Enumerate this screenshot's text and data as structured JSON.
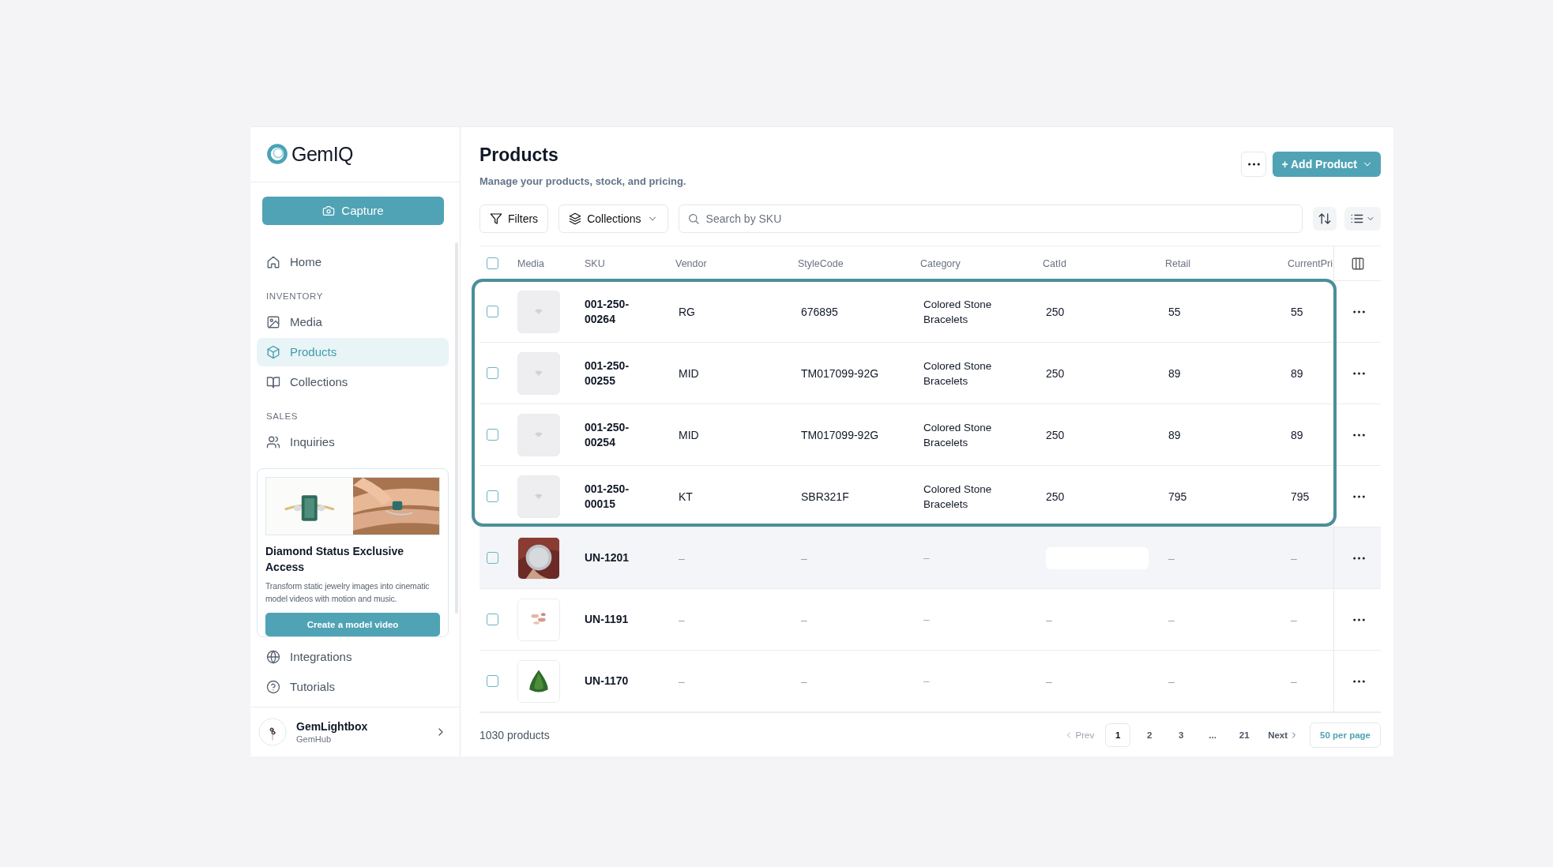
{
  "sidebar": {
    "logo": "GemIQ",
    "capture_button": "Capture",
    "top_items": [
      {
        "label": "Home",
        "selected": false
      }
    ],
    "sections": [
      {
        "heading": "INVENTORY",
        "items": [
          {
            "label": "Media",
            "selected": false
          },
          {
            "label": "Products",
            "selected": true
          },
          {
            "label": "Collections",
            "selected": false
          }
        ]
      },
      {
        "heading": "SALES",
        "items": [
          {
            "label": "Inquiries",
            "selected": false
          }
        ]
      }
    ],
    "promo": {
      "title": "Diamond Status Exclusive Access",
      "text": "Transform static jewelry images into cinematic model videos with motion and music.",
      "button": "Create a model video"
    },
    "bottom_items": [
      {
        "label": "Integrations",
        "selected": false
      },
      {
        "label": "Tutorials",
        "selected": false
      }
    ],
    "account": {
      "name": "GemLightbox",
      "org": "GemHub"
    }
  },
  "header": {
    "title": "Products",
    "subtitle": "Manage your products, stock, and pricing.",
    "add_button": "+ Add Product"
  },
  "toolbar": {
    "filters": "Filters",
    "collections": "Collections",
    "search": {
      "placeholder": "Search by SKU"
    }
  },
  "table": {
    "select_all_checked": false,
    "columns": [
      "Media",
      "SKU",
      "Vendor",
      "StyleCode",
      "Category",
      "CatId",
      "Retail",
      "CurrentPri"
    ],
    "rows": [
      {
        "media": {
          "kind": "placeholder"
        },
        "sku": "001-250-00264",
        "vendor": "RG",
        "style_code": "676895",
        "category": "Colored Stone Bracelets",
        "cat_id": "250",
        "retail": "55",
        "current_price": "55",
        "checked": false,
        "outlined": true,
        "hovered": false
      },
      {
        "media": {
          "kind": "placeholder"
        },
        "sku": "001-250-00255",
        "vendor": "MID",
        "style_code": "TM017099-92G",
        "category": "Colored Stone Bracelets",
        "cat_id": "250",
        "retail": "89",
        "current_price": "89",
        "checked": false,
        "outlined": true,
        "hovered": false
      },
      {
        "media": {
          "kind": "placeholder"
        },
        "sku": "001-250-00254",
        "vendor": "MID",
        "style_code": "TM017099-92G",
        "category": "Colored Stone Bracelets",
        "cat_id": "250",
        "retail": "89",
        "current_price": "89",
        "checked": false,
        "outlined": true,
        "hovered": false
      },
      {
        "media": {
          "kind": "placeholder"
        },
        "sku": "001-250-00015",
        "vendor": "KT",
        "style_code": "SBR321F",
        "category": "Colored Stone Bracelets",
        "cat_id": "250",
        "retail": "795",
        "current_price": "795",
        "checked": false,
        "outlined": true,
        "hovered": false
      },
      {
        "sku": "UN-1201",
        "vendor": "–",
        "style_code": "–",
        "category": "–",
        "retail": "–",
        "current_price": "–",
        "checked": false,
        "outlined": false,
        "hovered": true
      },
      {
        "sku": "UN-1191",
        "vendor": "–",
        "style_code": "–",
        "category": "–",
        "cat_id": "–",
        "retail": "–",
        "current_price": "–",
        "checked": false,
        "outlined": false,
        "hovered": false
      },
      {
        "sku": "UN-1170",
        "vendor": "–",
        "style_code": "–",
        "category": "–",
        "cat_id": "–",
        "retail": "–",
        "current_price": "–",
        "checked": false,
        "outlined": false,
        "hovered": false
      }
    ]
  },
  "footer": {
    "count": "1030 products",
    "prev": {
      "label": "Prev",
      "disabled": true
    },
    "pages": [
      {
        "label": "1",
        "selected": true
      },
      {
        "label": "2",
        "selected": false
      },
      {
        "label": "3",
        "selected": false
      },
      {
        "label": "...",
        "selected": false
      },
      {
        "label": "21",
        "selected": false
      }
    ],
    "next": {
      "label": "Next",
      "disabled": false
    },
    "per_page": "50 per page"
  }
}
